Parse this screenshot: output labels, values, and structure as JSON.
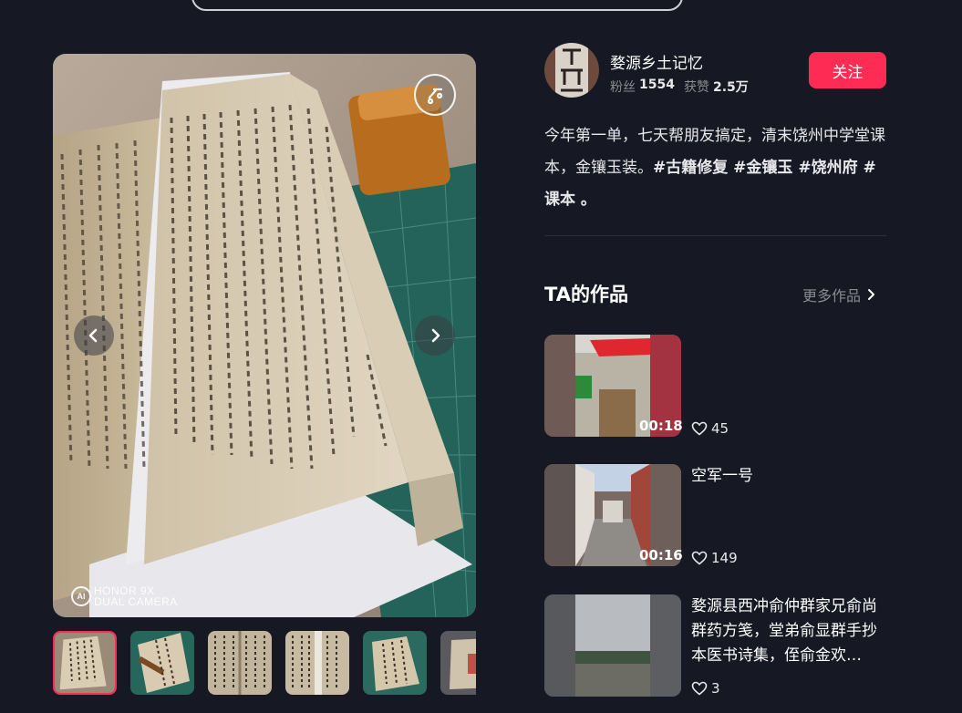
{
  "author": {
    "name": "婺源乡土记忆",
    "fans_label": "粉丝",
    "fans_value": "1554",
    "likes_label": "获赞",
    "likes_value": "2.5万",
    "follow_label": "关注"
  },
  "post": {
    "description": "今年第一单，七天帮朋友搞定，清末饶州中学堂课本，金镶玉装。",
    "hashtags": "#古籍修复 #金镶玉 #饶州府 #课本 。"
  },
  "viewer": {
    "watermark_logo": "AI",
    "watermark_line1": "HONOR 9X",
    "watermark_line2": "DUAL CAMERA",
    "thumbnail_count": 6,
    "active_index": 0
  },
  "works": {
    "title": "TA的作品",
    "more_label": "更多作品",
    "items": [
      {
        "title": "",
        "duration": "00:18",
        "likes": "45"
      },
      {
        "title": "空军一号",
        "duration": "00:16",
        "likes": "149"
      },
      {
        "title": "婺源县西冲俞仲群家兄俞尚群药方笺，堂弟俞显群手抄本医书诗集，侄俞金欢…",
        "duration": "",
        "likes": "3"
      }
    ]
  },
  "colors": {
    "background": "#161823",
    "accent": "#fe2c55",
    "muted_text": "#8a8b91"
  },
  "icons": [
    "chevron-left-icon",
    "chevron-right-icon",
    "music-note-icon",
    "heart-icon",
    "chevron-right-small-icon"
  ]
}
